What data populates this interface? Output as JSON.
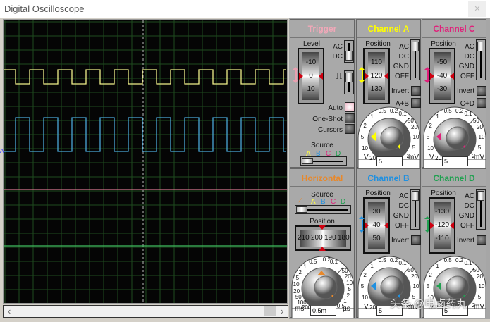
{
  "window": {
    "title": "Digital Oscilloscope",
    "close_icon": "close-icon"
  },
  "screen": {
    "channel_marker": "A",
    "grid": true,
    "traces": [
      {
        "channel": "A",
        "color": "#f0f08a",
        "shape": "square",
        "phase": "high-first"
      },
      {
        "channel": "B",
        "color": "#4aa8d8",
        "shape": "square",
        "phase": "low-first"
      },
      {
        "channel": "C",
        "color": "#d87890",
        "shape": "flat"
      },
      {
        "channel": "D",
        "color": "#40c060",
        "shape": "flat"
      }
    ]
  },
  "scrollbar": {
    "left": "‹",
    "right": "›"
  },
  "trigger": {
    "title": "Trigger",
    "title_color": "#f0a8b8",
    "level_label": "Level",
    "level_ticks": [
      "-10",
      "0",
      "10"
    ],
    "ac": "AC",
    "dc": "DC",
    "auto": "Auto",
    "one_shot": "One-Shot",
    "cursors": "Cursors",
    "source_label": "Source",
    "sources": [
      "A",
      "B",
      "C",
      "D"
    ]
  },
  "channels": {
    "A": {
      "title": "Channel A",
      "color": "#ffff00",
      "position_label": "Position",
      "ticks": [
        "110",
        "120",
        "130"
      ],
      "coupling": [
        "AC",
        "DC",
        "GND",
        "OFF"
      ],
      "invert": "Invert",
      "combine": "A+B",
      "volts": "5",
      "unit_left": "V",
      "unit_right": "mV",
      "scale_left": [
        "0.5",
        "1",
        "2",
        "5",
        "10",
        "20"
      ],
      "scale_top": [
        "0.2",
        "0.1"
      ],
      "scale_right": [
        "50",
        "20",
        "10",
        "5",
        "2"
      ]
    },
    "C": {
      "title": "Channel C",
      "color": "#e0207a",
      "position_label": "Position",
      "ticks": [
        "-50",
        "-40",
        "-30"
      ],
      "coupling": [
        "AC",
        "DC",
        "GND",
        "OFF"
      ],
      "invert": "Invert",
      "combine": "C+D",
      "volts": "5",
      "unit_left": "V",
      "unit_right": "mV",
      "scale_left": [
        "0.5",
        "1",
        "2",
        "5",
        "10",
        "20"
      ],
      "scale_top": [
        "0.2",
        "0.1"
      ],
      "scale_right": [
        "50",
        "20",
        "10",
        "5",
        "2"
      ]
    },
    "B": {
      "title": "Channel B",
      "color": "#2090e0",
      "position_label": "Position",
      "ticks": [
        "30",
        "40",
        "50"
      ],
      "coupling": [
        "AC",
        "DC",
        "GND",
        "OFF"
      ],
      "invert": "Invert",
      "volts": "5",
      "unit_left": "V",
      "unit_right": "mV",
      "scale_left": [
        "0.5",
        "1",
        "2",
        "5",
        "10",
        "20"
      ],
      "scale_top": [
        "0.2",
        "0.1"
      ],
      "scale_right": [
        "50",
        "20",
        "10",
        "5",
        "2"
      ]
    },
    "D": {
      "title": "Channel D",
      "color": "#20a050",
      "position_label": "Position",
      "ticks": [
        "-130",
        "-120",
        "-110"
      ],
      "coupling": [
        "AC",
        "DC",
        "GND",
        "OFF"
      ],
      "invert": "Invert",
      "volts": "5",
      "unit_left": "V",
      "unit_right": "mV",
      "scale_left": [
        "0.5",
        "1",
        "2",
        "5",
        "10",
        "20"
      ],
      "scale_top": [
        "0.2",
        "0.1"
      ],
      "scale_right": [
        "50",
        "20",
        "10",
        "5",
        "2"
      ]
    }
  },
  "horizontal": {
    "title": "Horizontal",
    "color": "#e8882a",
    "source_label": "Source",
    "sources": [
      "A",
      "B",
      "C",
      "D"
    ],
    "position_label": "Position",
    "position_ticks": [
      "210",
      "200",
      "190",
      "180"
    ],
    "timebase": "0.5m",
    "unit_left": "ms",
    "unit_right": "µs",
    "scale_left": [
      "200",
      "100",
      "50",
      "20",
      "10",
      "5",
      "2",
      "1",
      "0.5"
    ],
    "scale_top": [
      "0.2",
      "0.1"
    ],
    "scale_right": [
      "50",
      "20",
      "10",
      "5",
      "2",
      "1",
      "0.5"
    ]
  },
  "source_colors": {
    "A": "#ffff40",
    "B": "#2090e0",
    "C": "#e0207a",
    "D": "#20a050"
  },
  "watermark": "头条 @电卤药丸"
}
